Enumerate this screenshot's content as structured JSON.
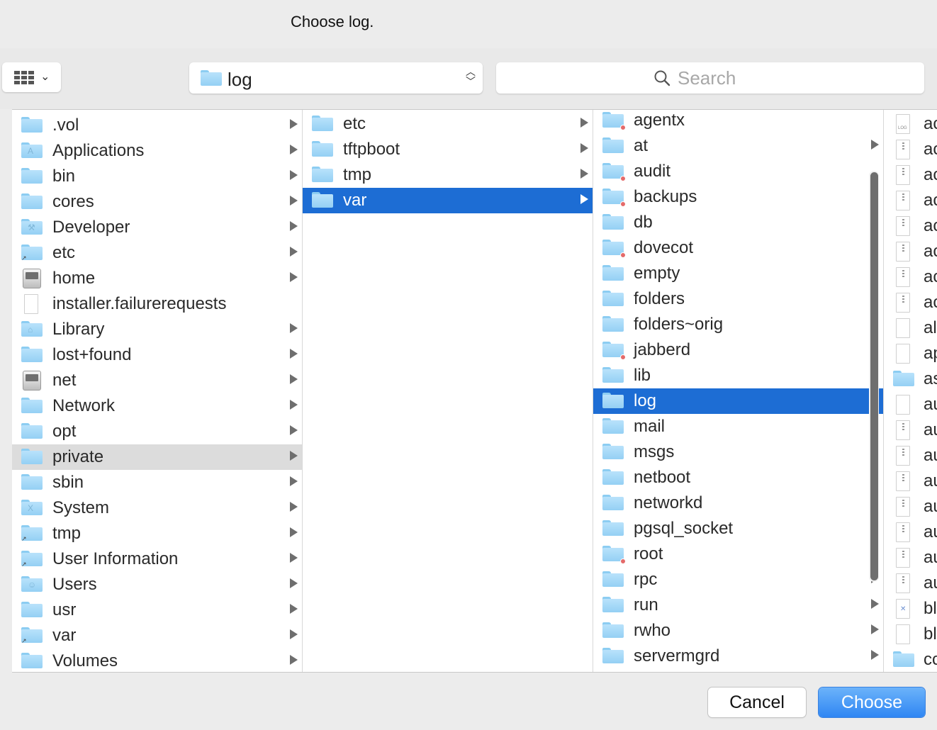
{
  "dialog": {
    "title": "Choose log."
  },
  "toolbar": {
    "path_folder": "log",
    "search_placeholder": "Search"
  },
  "columns": {
    "col1": [
      {
        "label": ".vol",
        "icon": "folder-icon",
        "arrow": true
      },
      {
        "label": "Applications",
        "icon": "applications-folder-icon",
        "arrow": true
      },
      {
        "label": "bin",
        "icon": "folder-icon",
        "arrow": true
      },
      {
        "label": "cores",
        "icon": "folder-icon",
        "arrow": true
      },
      {
        "label": "Developer",
        "icon": "developer-folder-icon",
        "arrow": true
      },
      {
        "label": "etc",
        "icon": "folder-alias-icon",
        "arrow": true
      },
      {
        "label": "home",
        "icon": "network-disk-icon",
        "arrow": true
      },
      {
        "label": "installer.failurerequests",
        "icon": "document-icon",
        "arrow": false
      },
      {
        "label": "Library",
        "icon": "library-folder-icon",
        "arrow": true
      },
      {
        "label": "lost+found",
        "icon": "folder-icon",
        "arrow": true
      },
      {
        "label": "net",
        "icon": "network-disk-icon",
        "arrow": true
      },
      {
        "label": "Network",
        "icon": "folder-icon",
        "arrow": true
      },
      {
        "label": "opt",
        "icon": "folder-icon",
        "arrow": true
      },
      {
        "label": "private",
        "icon": "folder-icon",
        "arrow": true,
        "state": "path"
      },
      {
        "label": "sbin",
        "icon": "folder-icon",
        "arrow": true
      },
      {
        "label": "System",
        "icon": "system-folder-icon",
        "arrow": true
      },
      {
        "label": "tmp",
        "icon": "folder-alias-icon",
        "arrow": true
      },
      {
        "label": "User Information",
        "icon": "folder-alias-icon",
        "arrow": true
      },
      {
        "label": "Users",
        "icon": "users-folder-icon",
        "arrow": true
      },
      {
        "label": "usr",
        "icon": "folder-icon",
        "arrow": true
      },
      {
        "label": "var",
        "icon": "folder-alias-icon",
        "arrow": true
      },
      {
        "label": "Volumes",
        "icon": "folder-icon",
        "arrow": true
      }
    ],
    "col2": [
      {
        "label": "etc",
        "icon": "folder-icon",
        "arrow": true
      },
      {
        "label": "tftpboot",
        "icon": "folder-icon",
        "arrow": true
      },
      {
        "label": "tmp",
        "icon": "folder-icon",
        "arrow": true
      },
      {
        "label": "var",
        "icon": "folder-icon",
        "arrow": true,
        "state": "selected"
      }
    ],
    "col3": [
      {
        "label": "agentx",
        "icon": "folder-restricted-icon",
        "arrow": false
      },
      {
        "label": "at",
        "icon": "folder-icon",
        "arrow": true
      },
      {
        "label": "audit",
        "icon": "folder-restricted-icon",
        "arrow": false
      },
      {
        "label": "backups",
        "icon": "folder-restricted-icon",
        "arrow": false
      },
      {
        "label": "db",
        "icon": "folder-icon",
        "arrow": true
      },
      {
        "label": "dovecot",
        "icon": "folder-restricted-icon",
        "arrow": false
      },
      {
        "label": "empty",
        "icon": "folder-icon",
        "arrow": true
      },
      {
        "label": "folders",
        "icon": "folder-icon",
        "arrow": true
      },
      {
        "label": "folders~orig",
        "icon": "folder-icon",
        "arrow": true
      },
      {
        "label": "jabberd",
        "icon": "folder-restricted-icon",
        "arrow": false
      },
      {
        "label": "lib",
        "icon": "folder-icon",
        "arrow": true
      },
      {
        "label": "log",
        "icon": "folder-icon",
        "arrow": true,
        "state": "selected"
      },
      {
        "label": "mail",
        "icon": "folder-icon",
        "arrow": true
      },
      {
        "label": "msgs",
        "icon": "folder-icon",
        "arrow": true
      },
      {
        "label": "netboot",
        "icon": "folder-icon",
        "arrow": true
      },
      {
        "label": "networkd",
        "icon": "folder-icon",
        "arrow": true
      },
      {
        "label": "pgsql_socket",
        "icon": "folder-icon",
        "arrow": true
      },
      {
        "label": "root",
        "icon": "folder-restricted-icon",
        "arrow": false
      },
      {
        "label": "rpc",
        "icon": "folder-icon",
        "arrow": true
      },
      {
        "label": "run",
        "icon": "folder-icon",
        "arrow": true
      },
      {
        "label": "rwho",
        "icon": "folder-icon",
        "arrow": true
      },
      {
        "label": "servermgrd",
        "icon": "folder-icon",
        "arrow": true
      }
    ],
    "col4": [
      {
        "label": "ac",
        "icon": "log-document-icon"
      },
      {
        "label": "ac",
        "icon": "archive-document-icon"
      },
      {
        "label": "ac",
        "icon": "archive-document-icon"
      },
      {
        "label": "ac",
        "icon": "archive-document-icon"
      },
      {
        "label": "ac",
        "icon": "archive-document-icon"
      },
      {
        "label": "ac",
        "icon": "archive-document-icon"
      },
      {
        "label": "ac",
        "icon": "archive-document-icon"
      },
      {
        "label": "ac",
        "icon": "archive-document-icon"
      },
      {
        "label": "al",
        "icon": "document-icon"
      },
      {
        "label": "ap",
        "icon": "document-icon"
      },
      {
        "label": "as",
        "icon": "folder-icon"
      },
      {
        "label": "au",
        "icon": "document-icon"
      },
      {
        "label": "au",
        "icon": "archive-document-icon"
      },
      {
        "label": "au",
        "icon": "archive-document-icon"
      },
      {
        "label": "au",
        "icon": "archive-document-icon"
      },
      {
        "label": "au",
        "icon": "archive-document-icon"
      },
      {
        "label": "au",
        "icon": "archive-document-icon"
      },
      {
        "label": "au",
        "icon": "archive-document-icon"
      },
      {
        "label": "au",
        "icon": "archive-document-icon"
      },
      {
        "label": "bl",
        "icon": "plist-document-icon"
      },
      {
        "label": "bl",
        "icon": "document-icon"
      },
      {
        "label": "cc",
        "icon": "folder-icon"
      }
    ]
  },
  "buttons": {
    "cancel": "Cancel",
    "choose": "Choose"
  },
  "colors": {
    "selection": "#1d6dd4",
    "path_highlight": "#dcdcdc",
    "default_button": "#2f86f3"
  }
}
